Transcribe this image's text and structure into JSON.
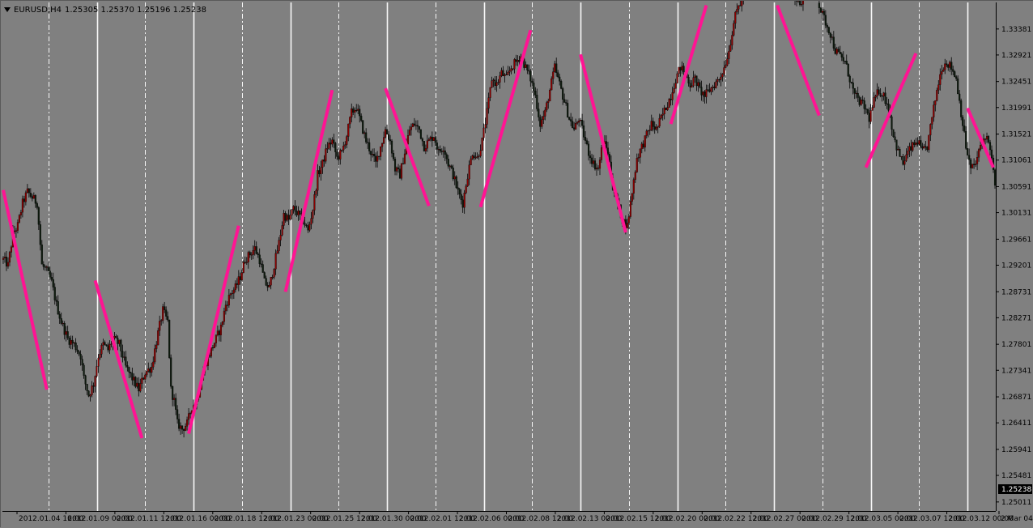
{
  "window": {
    "symbol_timeframe": "EURUSD,H4",
    "ohlc": "1.25305 1.25370 1.25196 1.25238"
  },
  "colors": {
    "background": "#808080",
    "bull_candle": "#8b0000",
    "bear_candle": "#0d1a0d",
    "trend_line": "#ff1493",
    "period_separator": "#ffffff",
    "current_price_bg": "#000000"
  },
  "chart_data": {
    "type": "candlestick",
    "symbol": "EURUSD",
    "timeframe": "H4",
    "ylim": [
      1.24851,
      1.33851
    ],
    "price_ticks": [
      "1.33381",
      "1.32921",
      "1.32451",
      "1.31991",
      "1.31521",
      "1.31061",
      "1.30591",
      "1.30131",
      "1.29661",
      "1.29201",
      "1.28731",
      "1.28271",
      "1.27801",
      "1.27341",
      "1.26871",
      "1.26411",
      "1.25941",
      "1.25481",
      "1.25011"
    ],
    "current_price": "1.25238",
    "time_ticks": [
      "2012.01.04 16:00",
      "2012.01.09 00:00",
      "2012.01.11 12:00",
      "2012.01.16 00:00",
      "2012.01.18 12:00",
      "2012.01.23 00:00",
      "2012.01.25 12:00",
      "2012.01.30 00:00",
      "2012.02.01 12:00",
      "2012.02.06 00:00",
      "2012.02.08 12:00",
      "2012.02.13 00:00",
      "2012.02.15 12:00",
      "2012.02.20 00:00",
      "2012.02.22 12:00",
      "2012.02.27 00:00",
      "2012.02.29 12:00",
      "2012.03.05 00:00",
      "2012.03.07 12:00",
      "2012.03.12 00:00",
      "2 Mar 04:00"
    ],
    "close_path": [
      [
        0,
        1.293
      ],
      [
        3,
        1.292
      ],
      [
        6,
        1.2975
      ],
      [
        9,
        1.299
      ],
      [
        12,
        1.303
      ],
      [
        15,
        1.305
      ],
      [
        18,
        1.304
      ],
      [
        21,
        1.303
      ],
      [
        24,
        1.292
      ],
      [
        27,
        1.291
      ],
      [
        30,
        1.289
      ],
      [
        33,
        1.285
      ],
      [
        36,
        1.282
      ],
      [
        40,
        1.279
      ],
      [
        44,
        1.278
      ],
      [
        48,
        1.276
      ],
      [
        50,
        1.272
      ],
      [
        53,
        1.269
      ],
      [
        56,
        1.271
      ],
      [
        59,
        1.276
      ],
      [
        62,
        1.278
      ],
      [
        65,
        1.277
      ],
      [
        68,
        1.279
      ],
      [
        72,
        1.278
      ],
      [
        76,
        1.274
      ],
      [
        80,
        1.272
      ],
      [
        84,
        1.27
      ],
      [
        88,
        1.273
      ],
      [
        92,
        1.274
      ],
      [
        96,
        1.28
      ],
      [
        99,
        1.284
      ],
      [
        102,
        1.282
      ],
      [
        104,
        1.27
      ],
      [
        106,
        1.268
      ],
      [
        108,
        1.264
      ],
      [
        111,
        1.263
      ],
      [
        114,
        1.264
      ],
      [
        117,
        1.267
      ],
      [
        120,
        1.268
      ],
      [
        123,
        1.272
      ],
      [
        126,
        1.275
      ],
      [
        129,
        1.277
      ],
      [
        132,
        1.279
      ],
      [
        135,
        1.281
      ],
      [
        138,
        1.285
      ],
      [
        141,
        1.287
      ],
      [
        144,
        1.288
      ],
      [
        147,
        1.29
      ],
      [
        150,
        1.293
      ],
      [
        153,
        1.294
      ],
      [
        156,
        1.295
      ],
      [
        159,
        1.293
      ],
      [
        162,
        1.289
      ],
      [
        165,
        1.288
      ],
      [
        168,
        1.292
      ],
      [
        171,
        1.296
      ],
      [
        174,
        1.301
      ],
      [
        177,
        1.3
      ],
      [
        180,
        1.302
      ],
      [
        183,
        1.301
      ],
      [
        186,
        1.3
      ],
      [
        189,
        1.298
      ],
      [
        192,
        1.302
      ],
      [
        195,
        1.308
      ],
      [
        198,
        1.31
      ],
      [
        201,
        1.313
      ],
      [
        204,
        1.314
      ],
      [
        207,
        1.311
      ],
      [
        210,
        1.312
      ],
      [
        213,
        1.315
      ],
      [
        216,
        1.319
      ],
      [
        219,
        1.32
      ],
      [
        222,
        1.317
      ],
      [
        225,
        1.314
      ],
      [
        228,
        1.312
      ],
      [
        231,
        1.31
      ],
      [
        234,
        1.313
      ],
      [
        237,
        1.316
      ],
      [
        240,
        1.314
      ],
      [
        243,
        1.309
      ],
      [
        246,
        1.308
      ],
      [
        249,
        1.312
      ],
      [
        252,
        1.316
      ],
      [
        255,
        1.317
      ],
      [
        258,
        1.316
      ],
      [
        261,
        1.313
      ],
      [
        264,
        1.314
      ],
      [
        267,
        1.315
      ],
      [
        270,
        1.312
      ],
      [
        273,
        1.313
      ],
      [
        276,
        1.31
      ],
      [
        279,
        1.308
      ],
      [
        282,
        1.305
      ],
      [
        285,
        1.303
      ],
      [
        288,
        1.308
      ],
      [
        291,
        1.312
      ],
      [
        294,
        1.311
      ],
      [
        297,
        1.314
      ],
      [
        300,
        1.319
      ],
      [
        303,
        1.325
      ],
      [
        306,
        1.324
      ],
      [
        309,
        1.326
      ],
      [
        312,
        1.325
      ],
      [
        315,
        1.327
      ],
      [
        318,
        1.328
      ],
      [
        321,
        1.329
      ],
      [
        324,
        1.327
      ],
      [
        327,
        1.325
      ],
      [
        330,
        1.322
      ],
      [
        333,
        1.317
      ],
      [
        336,
        1.319
      ],
      [
        339,
        1.323
      ],
      [
        342,
        1.327
      ],
      [
        345,
        1.324
      ],
      [
        348,
        1.321
      ],
      [
        351,
        1.318
      ],
      [
        354,
        1.316
      ],
      [
        357,
        1.318
      ],
      [
        360,
        1.315
      ],
      [
        363,
        1.312
      ],
      [
        366,
        1.31
      ],
      [
        369,
        1.309
      ],
      [
        372,
        1.314
      ],
      [
        375,
        1.312
      ],
      [
        378,
        1.306
      ],
      [
        381,
        1.303
      ],
      [
        384,
        1.3
      ],
      [
        387,
        1.299
      ],
      [
        390,
        1.305
      ],
      [
        393,
        1.311
      ],
      [
        396,
        1.313
      ],
      [
        399,
        1.315
      ],
      [
        402,
        1.317
      ],
      [
        405,
        1.316
      ],
      [
        408,
        1.318
      ],
      [
        411,
        1.32
      ],
      [
        414,
        1.322
      ],
      [
        417,
        1.325
      ],
      [
        420,
        1.327
      ],
      [
        423,
        1.326
      ],
      [
        426,
        1.324
      ],
      [
        429,
        1.325
      ],
      [
        432,
        1.323
      ],
      [
        435,
        1.322
      ],
      [
        438,
        1.323
      ],
      [
        441,
        1.324
      ],
      [
        444,
        1.325
      ],
      [
        447,
        1.327
      ],
      [
        450,
        1.33
      ],
      [
        453,
        1.335
      ],
      [
        456,
        1.338
      ],
      [
        459,
        1.339
      ],
      [
        462,
        1.342
      ],
      [
        465,
        1.344
      ],
      [
        468,
        1.345
      ],
      [
        471,
        1.346
      ],
      [
        474,
        1.347
      ],
      [
        477,
        1.346
      ],
      [
        480,
        1.345
      ],
      [
        483,
        1.344
      ],
      [
        486,
        1.342
      ],
      [
        489,
        1.34
      ],
      [
        492,
        1.339
      ],
      [
        495,
        1.338
      ],
      [
        498,
        1.34
      ],
      [
        501,
        1.341
      ],
      [
        504,
        1.34
      ],
      [
        507,
        1.337
      ],
      [
        510,
        1.335
      ],
      [
        513,
        1.333
      ],
      [
        516,
        1.33
      ],
      [
        519,
        1.329
      ],
      [
        522,
        1.328
      ],
      [
        525,
        1.325
      ],
      [
        528,
        1.322
      ],
      [
        531,
        1.321
      ],
      [
        534,
        1.32
      ],
      [
        537,
        1.318
      ],
      [
        540,
        1.321
      ],
      [
        543,
        1.323
      ],
      [
        546,
        1.322
      ],
      [
        549,
        1.32
      ],
      [
        552,
        1.315
      ],
      [
        555,
        1.312
      ],
      [
        558,
        1.31
      ],
      [
        561,
        1.312
      ],
      [
        564,
        1.313
      ],
      [
        567,
        1.314
      ],
      [
        570,
        1.312
      ],
      [
        573,
        1.313
      ],
      [
        576,
        1.318
      ],
      [
        579,
        1.323
      ],
      [
        582,
        1.327
      ],
      [
        585,
        1.328
      ],
      [
        588,
        1.327
      ],
      [
        591,
        1.325
      ],
      [
        594,
        1.319
      ],
      [
        597,
        1.313
      ],
      [
        600,
        1.309
      ],
      [
        603,
        1.31
      ],
      [
        606,
        1.313
      ],
      [
        609,
        1.315
      ],
      [
        612,
        1.313
      ],
      [
        615,
        1.306
      ]
    ],
    "trend_lines": [
      [
        [
          1.3053,
          0
        ],
        [
          1.27,
          27
        ]
      ],
      [
        [
          1.2893,
          57
        ],
        [
          1.2614,
          86
        ]
      ],
      [
        [
          1.2622,
          115
        ],
        [
          1.299,
          146
        ]
      ],
      [
        [
          1.2873,
          175
        ],
        [
          1.323,
          204
        ]
      ],
      [
        [
          1.3233,
          237
        ],
        [
          1.3025,
          264
        ]
      ],
      [
        [
          1.3023,
          296
        ],
        [
          1.3336,
          327
        ]
      ],
      [
        [
          1.3293,
          358
        ],
        [
          1.2978,
          386
        ]
      ],
      [
        [
          1.317,
          414
        ],
        [
          1.338,
          436
        ]
      ],
      [
        [
          1.338,
          480
        ],
        [
          1.3185,
          506
        ]
      ],
      [
        [
          1.3093,
          535
        ],
        [
          1.3295,
          566
        ]
      ],
      [
        [
          1.3198,
          598
        ],
        [
          1.3093,
          614
        ]
      ]
    ]
  }
}
